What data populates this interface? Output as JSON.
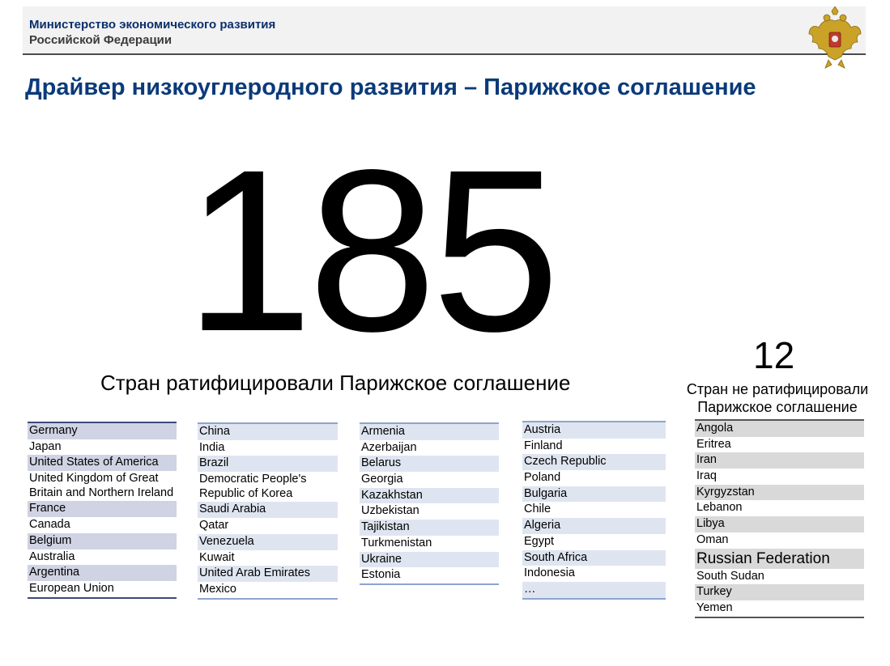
{
  "header": {
    "ministry_line1": "Министерство экономического развития",
    "ministry_line2": "Российской Федерации"
  },
  "title": "Драйвер низкоуглеродного развития – Парижское соглашение",
  "ratified": {
    "count": "185",
    "caption": "Стран ратифицировали Парижское соглашение"
  },
  "not_ratified": {
    "count": "12",
    "caption_line1": "Стран не ратифицировали",
    "caption_line2": "Парижское соглашение"
  },
  "col1": [
    "Germany",
    "Japan",
    "United States of America",
    "United Kingdom of Great Britain and Northern Ireland",
    "France",
    "Canada",
    "Belgium",
    "Australia",
    "Argentina",
    "European Union"
  ],
  "col2": [
    "China",
    "India",
    "Brazil",
    "Democratic People's Republic of Korea",
    "Saudi Arabia",
    "Qatar",
    "Venezuela",
    "Kuwait",
    "United Arab Emirates",
    "Mexico"
  ],
  "col3": [
    "Armenia",
    "Azerbaijan",
    "Belarus",
    "Georgia",
    "Kazakhstan",
    "Uzbekistan",
    "Tajikistan",
    "Turkmenistan",
    "Ukraine",
    "Estonia"
  ],
  "col4": [
    "Austria",
    "Finland",
    "Czech Republic",
    "Poland",
    "Bulgaria",
    "Chile",
    "Algeria",
    "Egypt",
    "South Africa",
    "Indonesia",
    "…"
  ],
  "col5": [
    "Angola",
    "Eritrea",
    "Iran",
    "Iraq",
    "Kyrgyzstan",
    "Lebanon",
    "Libya",
    "Oman",
    "Russian Federation",
    "South Sudan",
    "Turkey",
    "Yemen"
  ],
  "colors": {
    "title_blue": "#0b3a7a",
    "ministry_blue": "#0b2f6b",
    "emblem_gold": "#c9a227"
  }
}
